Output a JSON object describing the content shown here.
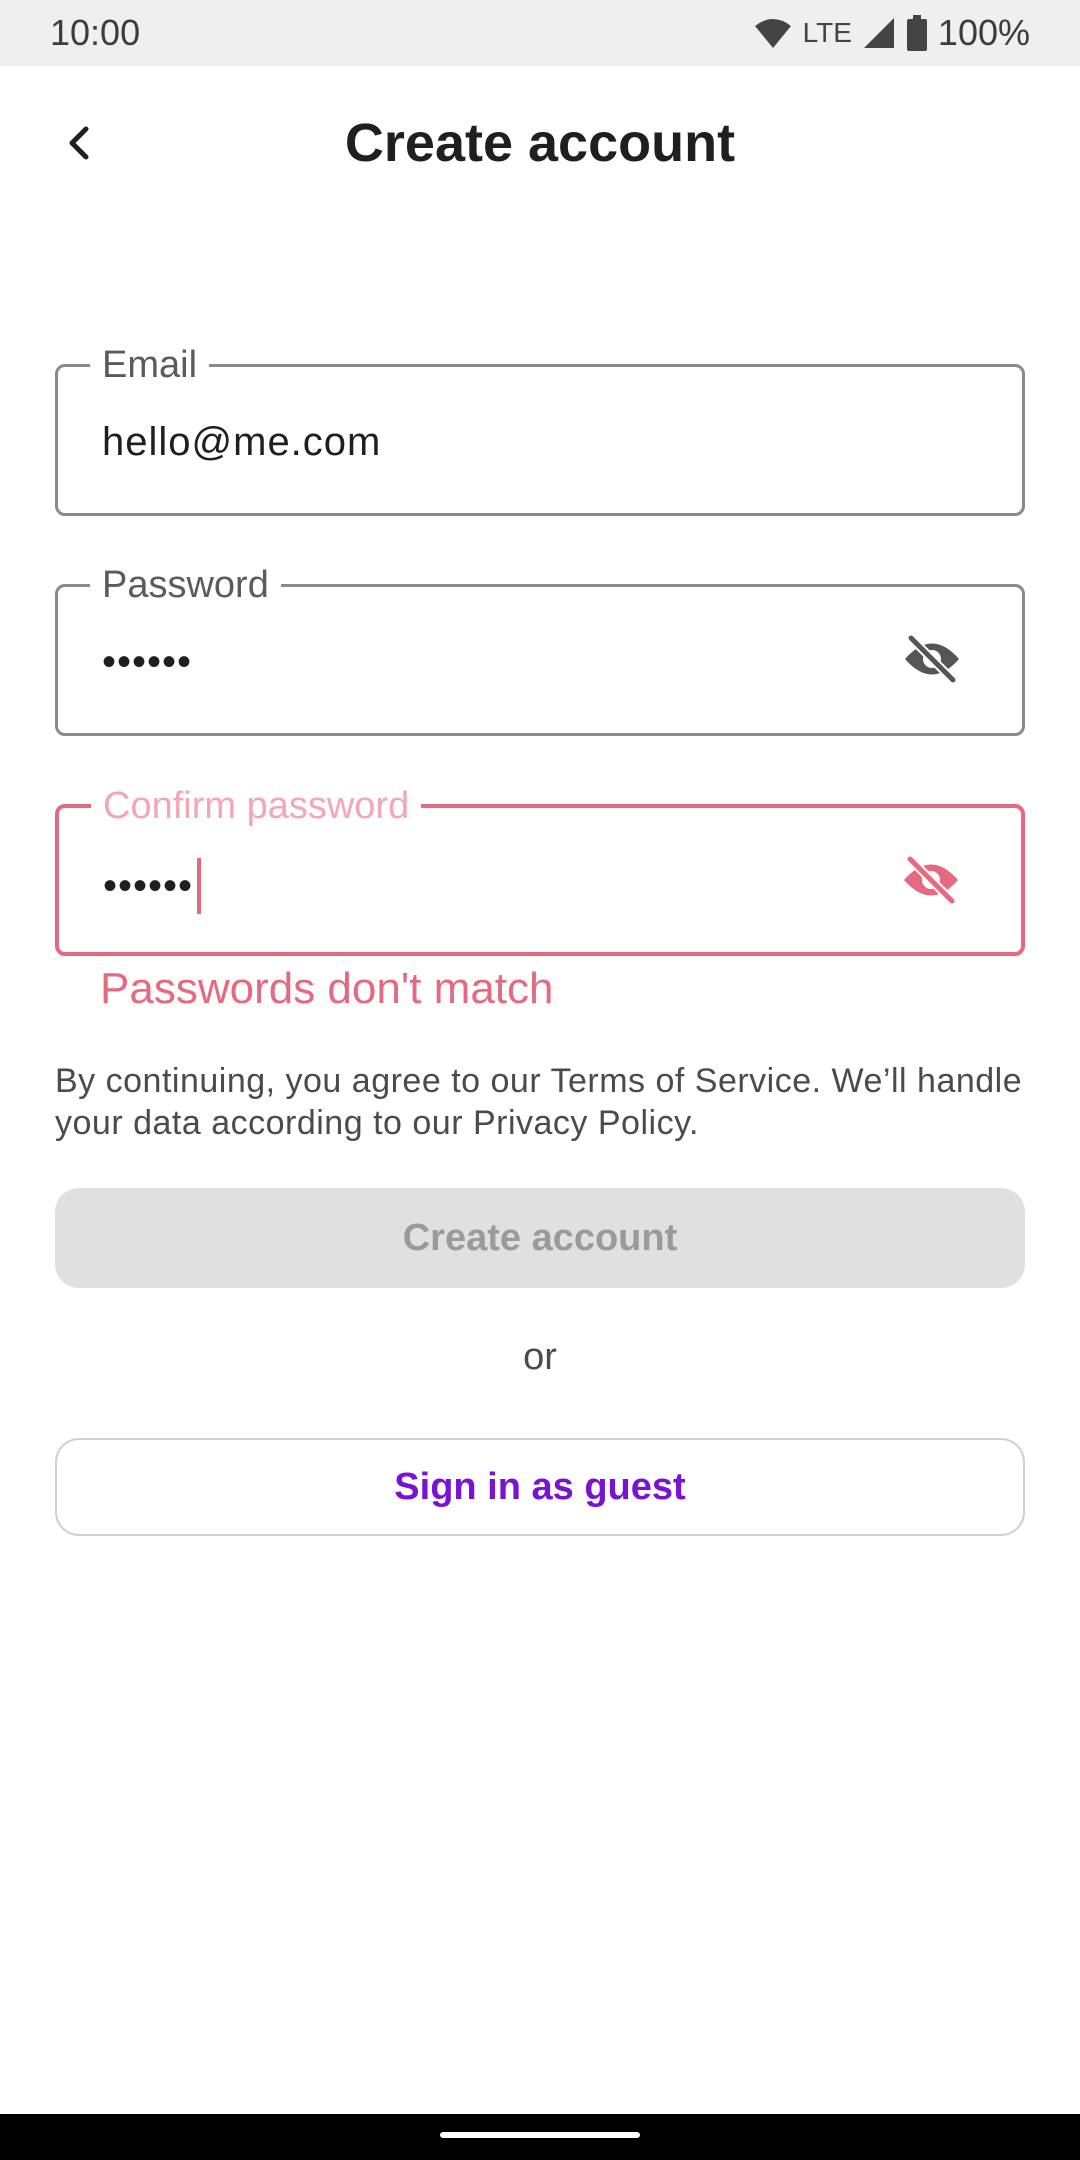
{
  "status_bar": {
    "time": "10:00",
    "network": "LTE",
    "battery": "100%",
    "icons": [
      "wifi-icon",
      "signal-icon",
      "battery-icon"
    ]
  },
  "header": {
    "title": "Create account",
    "back_icon": "chevron-left-icon"
  },
  "form": {
    "email": {
      "label": "Email",
      "value": "hello@me.com"
    },
    "password": {
      "label": "Password",
      "value": "••••••",
      "toggle_icon": "eye-off-icon"
    },
    "confirm_password": {
      "label": "Confirm password",
      "value": "••••••",
      "toggle_icon": "eye-off-icon",
      "error": "Passwords don't match"
    }
  },
  "terms_text": "By continuing, you agree to our Terms of Service. We’ll handle your data according to our Privacy Policy.",
  "buttons": {
    "create_account": "Create account",
    "or": "or",
    "guest": "Sign in as guest"
  },
  "colors": {
    "error": "#e56a80",
    "error_label": "#f3a6b6",
    "accent": "#7a12d4",
    "disabled_bg": "#e0e0e0",
    "disabled_text": "#9a9a9a"
  }
}
